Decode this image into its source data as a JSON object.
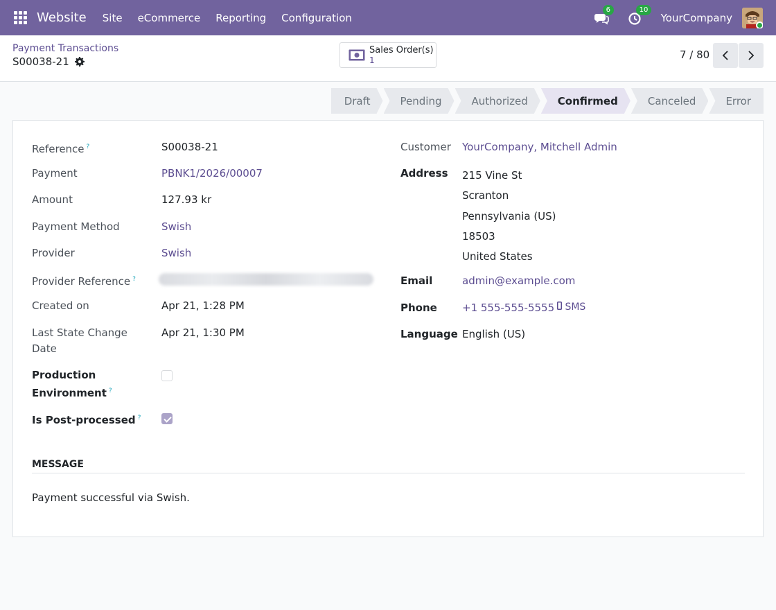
{
  "navbar": {
    "brand": "Website",
    "menu": [
      "Site",
      "eCommerce",
      "Reporting",
      "Configuration"
    ],
    "messages_count": "6",
    "activities_count": "10",
    "company": "YourCompany"
  },
  "control_panel": {
    "breadcrumb": "Payment Transactions",
    "record": "S00038-21",
    "smart_button": {
      "label": "Sales Order(s)",
      "count": "1"
    },
    "pager": "7 / 80"
  },
  "statusbar": {
    "stages": [
      "Draft",
      "Pending",
      "Authorized",
      "Confirmed",
      "Canceled",
      "Error"
    ],
    "active": "Confirmed"
  },
  "fields_left": [
    {
      "label": "Reference",
      "value": "S00038-21"
    },
    {
      "label": "Payment",
      "value": "PBNK1/2026/00007"
    },
    {
      "label": "Amount",
      "value": "127.93 kr"
    },
    {
      "label": "Payment Method",
      "value": "Swish"
    },
    {
      "label": "Provider",
      "value": "Swish"
    },
    {
      "label": "Provider Reference",
      "value": ""
    },
    {
      "label": "Created on",
      "value": "Apr 21, 1:28 PM"
    },
    {
      "label": "Last State Change",
      "label2": "Date",
      "value": "Apr 21, 1:30 PM"
    },
    {
      "label": "Production",
      "label2": "Environment",
      "value": ""
    },
    {
      "label": "Is Post-processed",
      "value": ""
    }
  ],
  "fields_right": {
    "customer_label": "Customer",
    "customer": "YourCompany, Mitchell Admin",
    "address_label": "Address",
    "address": [
      "215 Vine St",
      "Scranton",
      "Pennsylvania (US)",
      "18503",
      "United States"
    ],
    "email_label": "Email",
    "email": "admin@example.com",
    "phone_label": "Phone",
    "phone": "+1 555-555-5555",
    "sms": "SMS",
    "language_label": "Language",
    "language": "English (US)"
  },
  "message": {
    "title": "MESSAGE",
    "text": "Payment successful via Swish."
  }
}
